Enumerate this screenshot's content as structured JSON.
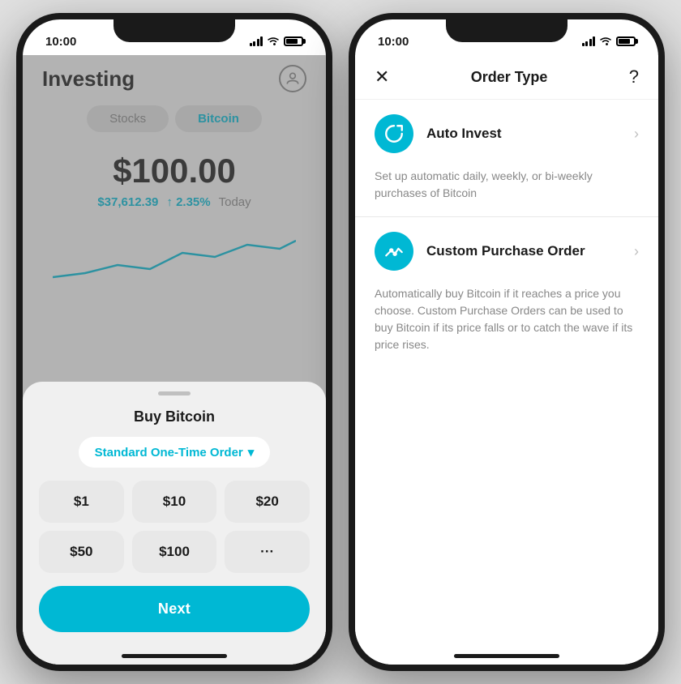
{
  "left_phone": {
    "status_time": "10:00",
    "title": "Investing",
    "tabs": [
      {
        "label": "Stocks",
        "active": false
      },
      {
        "label": "Bitcoin",
        "active": true
      }
    ],
    "main_price": "$100.00",
    "price_ref": "$37,612.39",
    "price_pct": "2.35%",
    "today": "Today",
    "chart_icon": "∧",
    "bottom_sheet": {
      "title": "Buy Bitcoin",
      "order_type": "Standard One-Time Order",
      "order_type_dropdown": "▾",
      "amounts": [
        "$1",
        "$10",
        "$20",
        "$50",
        "$100",
        "···"
      ],
      "next_label": "Next"
    }
  },
  "right_phone": {
    "status_time": "10:00",
    "header": {
      "close": "✕",
      "title": "Order Type",
      "help": "?"
    },
    "options": [
      {
        "icon": "↺",
        "name": "Auto Invest",
        "description": "Set up automatic daily, weekly, or bi-weekly purchases of Bitcoin"
      },
      {
        "icon": "⤡",
        "name": "Custom Purchase Order",
        "description": "Automatically buy Bitcoin if it reaches a price you choose. Custom Purchase Orders can be used to buy Bitcoin if its price falls or to catch the wave if its price rises."
      }
    ]
  }
}
